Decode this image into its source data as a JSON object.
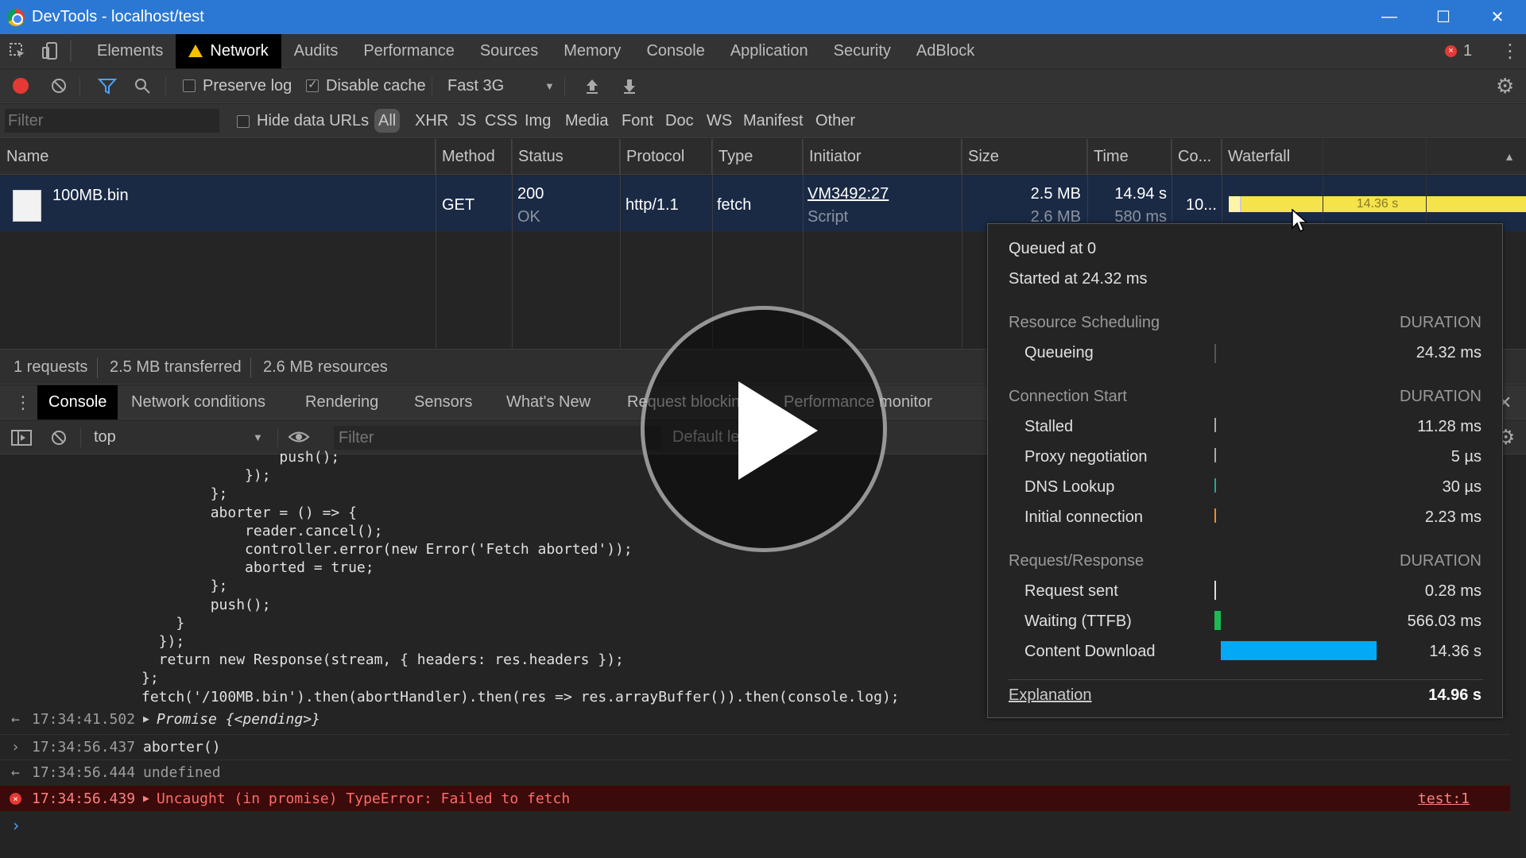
{
  "window": {
    "title": "DevTools - localhost/test",
    "controls": [
      "minimize",
      "maximize",
      "close"
    ]
  },
  "panels": {
    "tabs": [
      "Elements",
      "Network",
      "Audits",
      "Performance",
      "Sources",
      "Memory",
      "Console",
      "Application",
      "Security",
      "AdBlock"
    ],
    "active": "Network",
    "error_count": "1"
  },
  "toolbar": {
    "preserve_log": "Preserve log",
    "preserve_log_checked": false,
    "disable_cache": "Disable cache",
    "disable_cache_checked": true,
    "throttling": "Fast 3G"
  },
  "filterbar": {
    "placeholder": "Filter",
    "hide_data_urls": "Hide data URLs",
    "types": [
      "All",
      "XHR",
      "JS",
      "CSS",
      "Img",
      "Media",
      "Font",
      "Doc",
      "WS",
      "Manifest",
      "Other"
    ],
    "active_type": "All"
  },
  "table": {
    "columns": [
      "Name",
      "Method",
      "Status",
      "Protocol",
      "Type",
      "Initiator",
      "Size",
      "Time",
      "Co...",
      "Waterfall"
    ],
    "rows": [
      {
        "name": "100MB.bin",
        "method": "GET",
        "status": "200",
        "status_text": "OK",
        "protocol": "http/1.1",
        "type": "fetch",
        "initiator": "VM3492:27",
        "initiator_type": "Script",
        "size": "2.5 MB",
        "size_resource": "2.6 MB",
        "time": "14.94 s",
        "latency": "580 ms",
        "connection": "10...",
        "waterfall_label": "14.36 s"
      }
    ]
  },
  "summary": {
    "requests": "1 requests",
    "transferred": "2.5 MB transferred",
    "resources": "2.6 MB resources"
  },
  "drawer": {
    "tabs": [
      "Console",
      "Network conditions",
      "Rendering",
      "Sensors",
      "What's New",
      "Request blocking",
      "Performance monitor"
    ],
    "active": "Console",
    "context": "top",
    "filter_placeholder": "Filter",
    "levels": "Default le"
  },
  "console": {
    "code_lines": [
      "                push();",
      "            });",
      "        };",
      "        aborter = () => {",
      "            reader.cancel();",
      "            controller.error(new Error('Fetch aborted'));",
      "            aborted = true;",
      "        };",
      "        push();",
      "    }",
      "  });",
      "  return new Response(stream, { headers: res.headers });",
      "};",
      "fetch('/100MB.bin').then(abortHandler).then(res => res.arrayBuffer()).then(console.log);"
    ],
    "entries": [
      {
        "kind": "result",
        "time": "17:34:41.502",
        "text": "Promise {<pending>}"
      },
      {
        "kind": "input",
        "time": "17:34:56.437",
        "text": "aborter()"
      },
      {
        "kind": "result",
        "time": "17:34:56.444",
        "text": "undefined"
      },
      {
        "kind": "error",
        "time": "17:34:56.439",
        "text": "Uncaught (in promise) TypeError: Failed to fetch",
        "source": "test:1"
      }
    ]
  },
  "timing_popover": {
    "queued": "Queued at 0",
    "started": "Started at 24.32 ms",
    "sections": [
      {
        "title": "Resource Scheduling",
        "label": "DURATION",
        "rows": [
          {
            "name": "Queueing",
            "value": "24.32 ms"
          }
        ]
      },
      {
        "title": "Connection Start",
        "label": "DURATION",
        "rows": [
          {
            "name": "Stalled",
            "value": "11.28 ms"
          },
          {
            "name": "Proxy negotiation",
            "value": "5 µs"
          },
          {
            "name": "DNS Lookup",
            "value": "30 µs"
          },
          {
            "name": "Initial connection",
            "value": "2.23 ms"
          }
        ]
      },
      {
        "title": "Request/Response",
        "label": "DURATION",
        "rows": [
          {
            "name": "Request sent",
            "value": "0.28 ms"
          },
          {
            "name": "Waiting (TTFB)",
            "value": "566.03 ms"
          },
          {
            "name": "Content Download",
            "value": "14.36 s"
          }
        ]
      }
    ],
    "explanation": "Explanation",
    "total": "14.96 s"
  },
  "colors": {
    "titlebar": "#2b78d4",
    "waterfall_bar": "#f4e34b",
    "ttfb": "#1db954",
    "download": "#03a9f4",
    "error": "#ff6b6b"
  }
}
